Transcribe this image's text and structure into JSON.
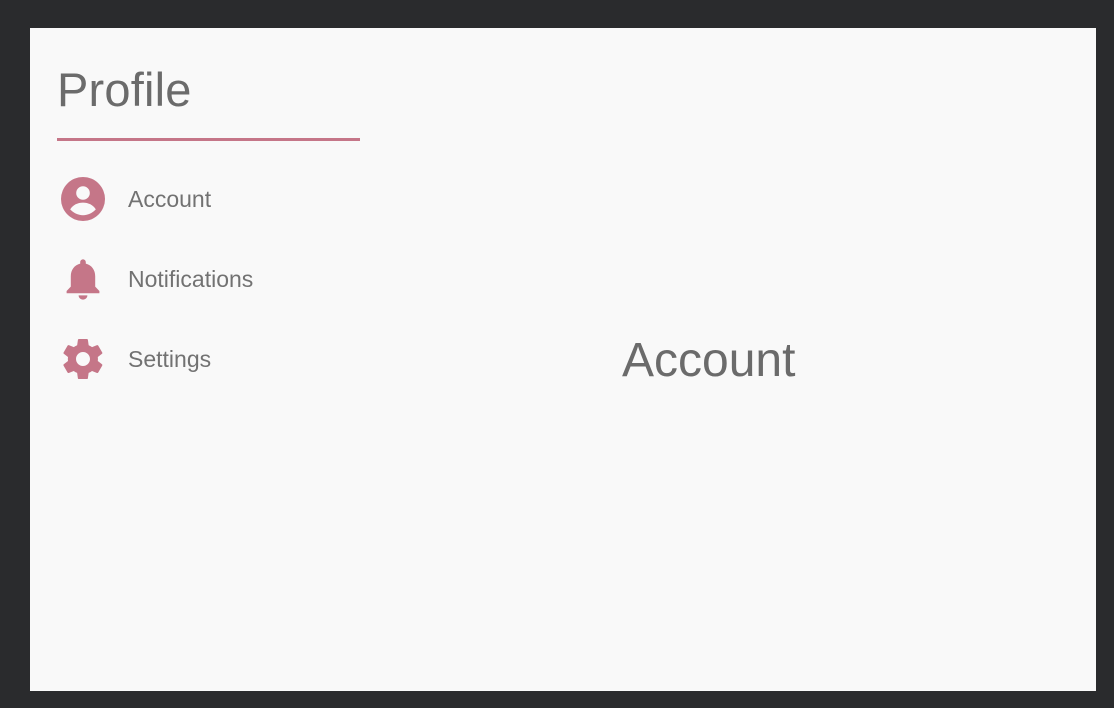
{
  "sidebar": {
    "title": "Profile",
    "items": [
      {
        "label": "Account",
        "icon": "account-circle-icon"
      },
      {
        "label": "Notifications",
        "icon": "bell-icon"
      },
      {
        "label": "Settings",
        "icon": "gear-icon"
      }
    ]
  },
  "main": {
    "title": "Account"
  },
  "colors": {
    "accent": "#c57688",
    "background": "#f9f9f9",
    "window_bg": "#2a2b2d",
    "text": "#6b6b6b"
  }
}
